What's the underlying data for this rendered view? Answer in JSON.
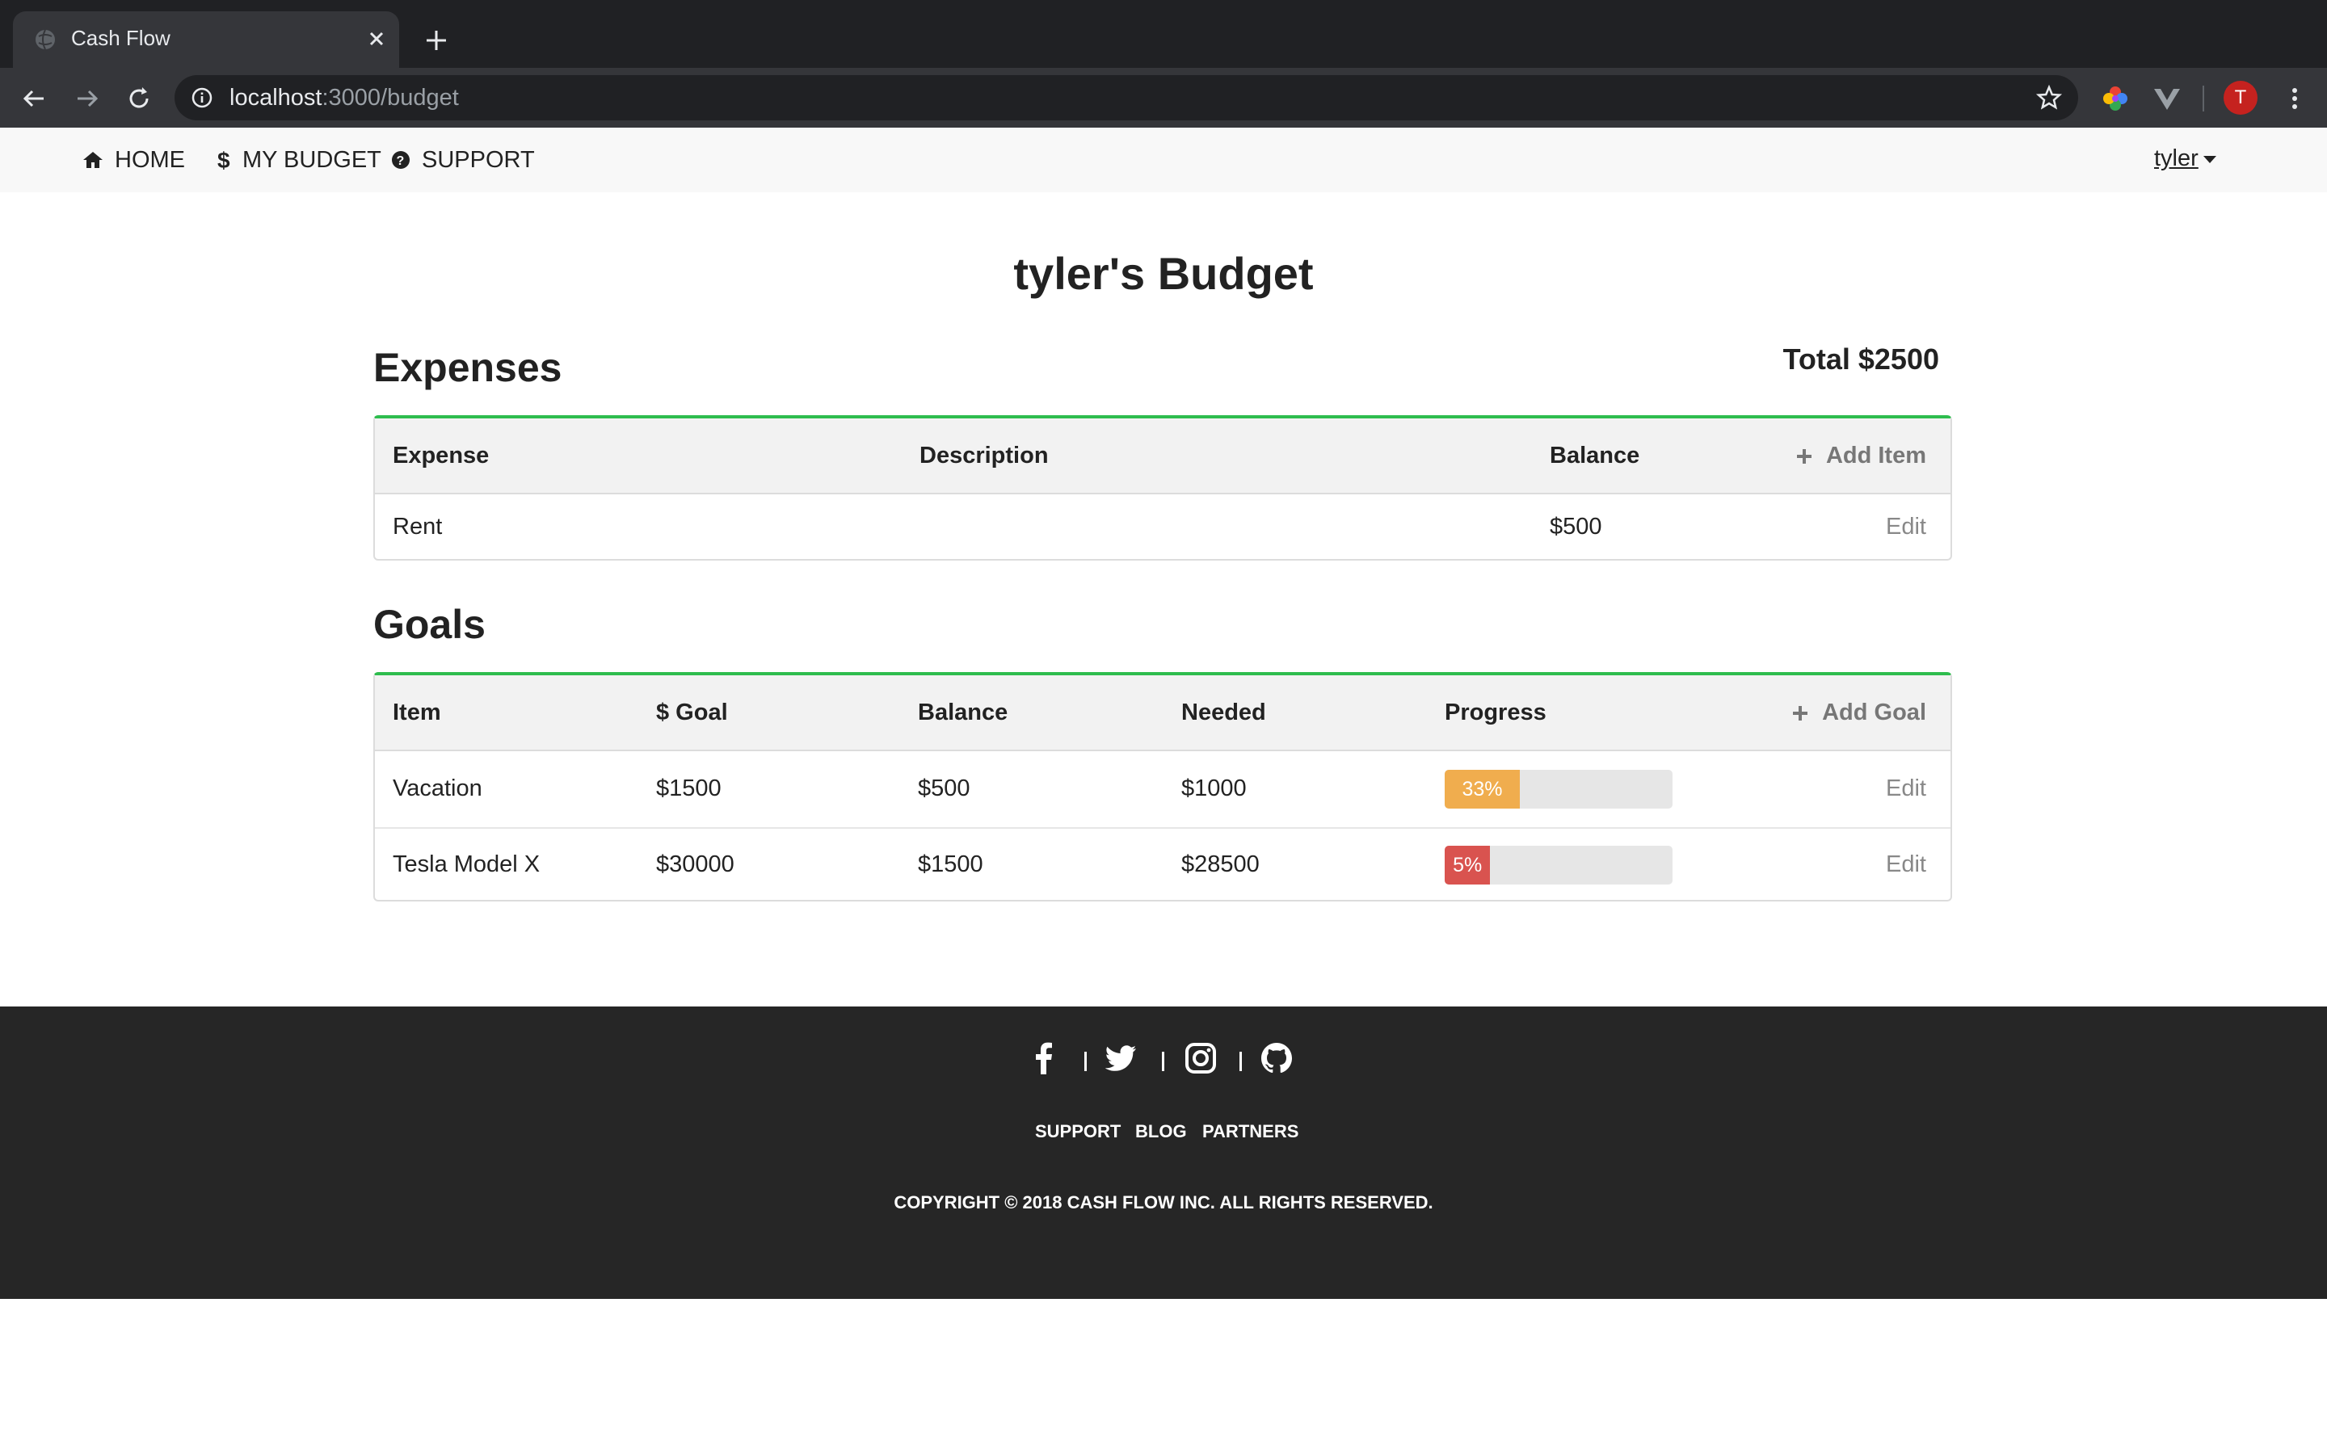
{
  "browser": {
    "tab_title": "Cash Flow",
    "url_host": "localhost",
    "url_rest": ":3000/budget",
    "profile_initial": "T"
  },
  "nav": {
    "home": "HOME",
    "budget": "MY BUDGET",
    "support": "SUPPORT",
    "user": "tyler"
  },
  "page": {
    "title": "tyler's Budget"
  },
  "expenses": {
    "title": "Expenses",
    "total": "Total $2500",
    "add_label": "Add Item",
    "headers": {
      "expense": "Expense",
      "description": "Description",
      "balance": "Balance"
    },
    "rows": [
      {
        "expense": "Rent",
        "description": "",
        "balance": "$500",
        "edit": "Edit"
      }
    ]
  },
  "goals": {
    "title": "Goals",
    "add_label": "Add Goal",
    "headers": {
      "item": "Item",
      "goal": "$ Goal",
      "balance": "Balance",
      "needed": "Needed",
      "progress": "Progress"
    },
    "rows": [
      {
        "item": "Vacation",
        "goal": "$1500",
        "balance": "$500",
        "needed": "$1000",
        "progress_label": "33%",
        "progress_value": 33,
        "progress_color": "#f0ad4e",
        "edit": "Edit"
      },
      {
        "item": "Tesla Model X",
        "goal": "$30000",
        "balance": "$1500",
        "needed": "$28500",
        "progress_label": "5%",
        "progress_value": 5,
        "progress_color": "#d9534f",
        "edit": "Edit"
      }
    ]
  },
  "footer": {
    "links": [
      "SUPPORT",
      "BLOG",
      "PARTNERS"
    ],
    "social_icons": [
      "facebook-icon",
      "twitter-icon",
      "instagram-icon",
      "github-icon"
    ],
    "copyright": "COPYRIGHT © 2018 CASH FLOW INC.  ALL RIGHTS RESERVED."
  },
  "colors": {
    "accent_border": "#2ebd4e",
    "warning": "#f0ad4e",
    "danger": "#d9534f"
  }
}
